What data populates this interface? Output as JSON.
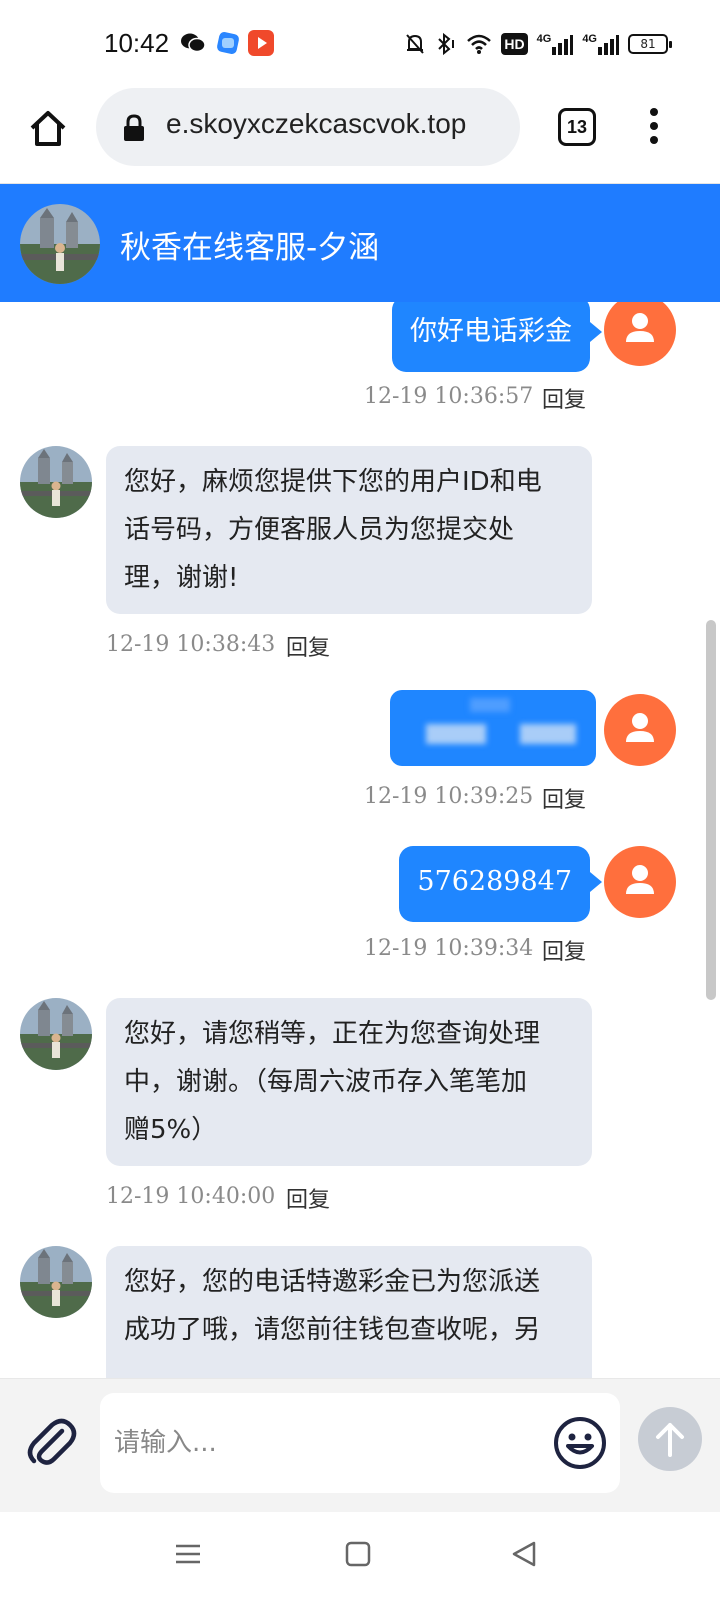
{
  "status_bar": {
    "time": "10:42",
    "app_icons": [
      "wechat-icon",
      "app-blue-icon",
      "video-app-icon"
    ],
    "signal_label_1": "4G",
    "signal_label_2": "4G",
    "hd_label": "HD",
    "battery": "81"
  },
  "browser": {
    "url": "e.skoyxczekcascvok.top",
    "tab_count": "13"
  },
  "chat_header": {
    "title": "秋香在线客服-夕涵",
    "color": "#1f7cff"
  },
  "messages": [
    {
      "sender": "user",
      "text": "你好电话彩金",
      "time": "12-19 10:36:57",
      "reply": "回复"
    },
    {
      "sender": "agent",
      "lines": [
        "您好，麻烦您提供下您的用户ID和电",
        "话号码，方便客服人员为您提交处",
        "理，谢谢!"
      ],
      "time": "12-19 10:38:43",
      "reply": "回复"
    },
    {
      "sender": "user",
      "text": "",
      "redacted": true,
      "time": "12-19 10:39:25",
      "reply": "回复"
    },
    {
      "sender": "user",
      "text": "576289847",
      "time": "12-19 10:39:34",
      "reply": "回复"
    },
    {
      "sender": "agent",
      "lines": [
        "您好，请您稍等，正在为您查询处理",
        "中，谢谢。（每周六波币存入笔笔加",
        "赠5%）"
      ],
      "time": "12-19 10:40:00",
      "reply": "回复"
    },
    {
      "sender": "agent",
      "lines": [
        "您好，您的电话特邀彩金已为您派送",
        "成功了哦，请您前往钱包查收呢，另"
      ]
    }
  ],
  "input": {
    "placeholder": "请输入..."
  },
  "colors": {
    "user_bubble": "#1f86ff",
    "agent_bubble": "#e5e9f1",
    "user_avatar": "#ff6f3d",
    "send_button": "#c7ccd4"
  }
}
